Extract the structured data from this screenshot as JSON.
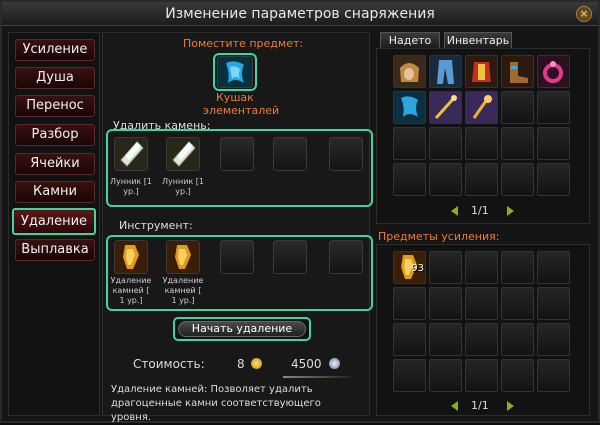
{
  "window": {
    "title": "Изменение параметров снаряжения",
    "close_label": "×"
  },
  "nav": [
    {
      "label": "Усиление"
    },
    {
      "label": "Душа"
    },
    {
      "label": "Перенос"
    },
    {
      "label": "Разбор"
    },
    {
      "label": "Ячейки"
    },
    {
      "label": "Камни"
    },
    {
      "label": "Удаление"
    },
    {
      "label": "Выплавка"
    }
  ],
  "center": {
    "place_item_label": "Поместите предмет:",
    "item_name_line1": "Кушак",
    "item_name_line2": "элементалей",
    "remove_stones_label": "Удалить камень:",
    "stones": [
      {
        "name_line1": "Лунник [1",
        "name_line2": "ур.]"
      },
      {
        "name_line1": "Лунник [1",
        "name_line2": "ур.]"
      }
    ],
    "tool_label": "Инструмент:",
    "tools": [
      {
        "name_line1": "Удаление",
        "name_line2": "камней [",
        "name_line3": "1 ур.]"
      },
      {
        "name_line1": "Удаление",
        "name_line2": "камней [",
        "name_line3": "1 ур.]"
      }
    ],
    "start_button": "Начать удаление",
    "cost_label": "Стоимость:",
    "cost_gold": "8",
    "cost_silver": "4500",
    "description": "Удаление камней: Позволяет удалить драгоценные камни соответствующего уровня."
  },
  "right": {
    "tabs": [
      {
        "label": "Надето"
      },
      {
        "label": "Инвентарь"
      }
    ],
    "page_top": "1/1",
    "boost_label": "Предметы усиления:",
    "boost_count": "93",
    "page_bottom": "1/1"
  },
  "colors": {
    "accent": "#3cd6a0",
    "orange": "#f07a3a"
  }
}
